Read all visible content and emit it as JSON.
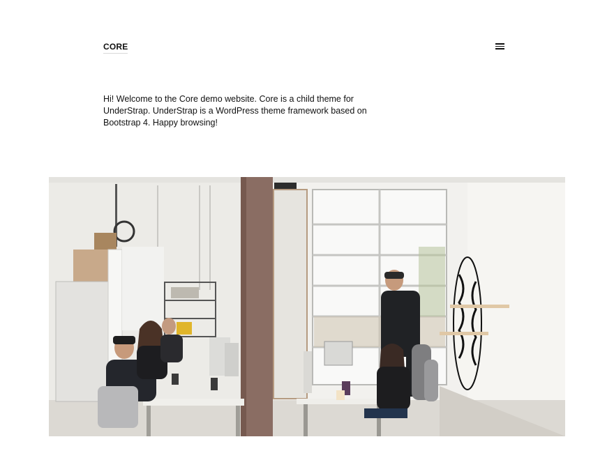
{
  "header": {
    "logo_text": "CORE",
    "menu_icon": "hamburger-menu-icon"
  },
  "intro": {
    "text": "Hi! Welcome to the Core demo website. Core is a child theme for UnderStrap. UnderStrap is a WordPress theme framework based on Bootstrap 4. Happy browsing!"
  },
  "hero": {
    "image_icon": "office-photo"
  }
}
